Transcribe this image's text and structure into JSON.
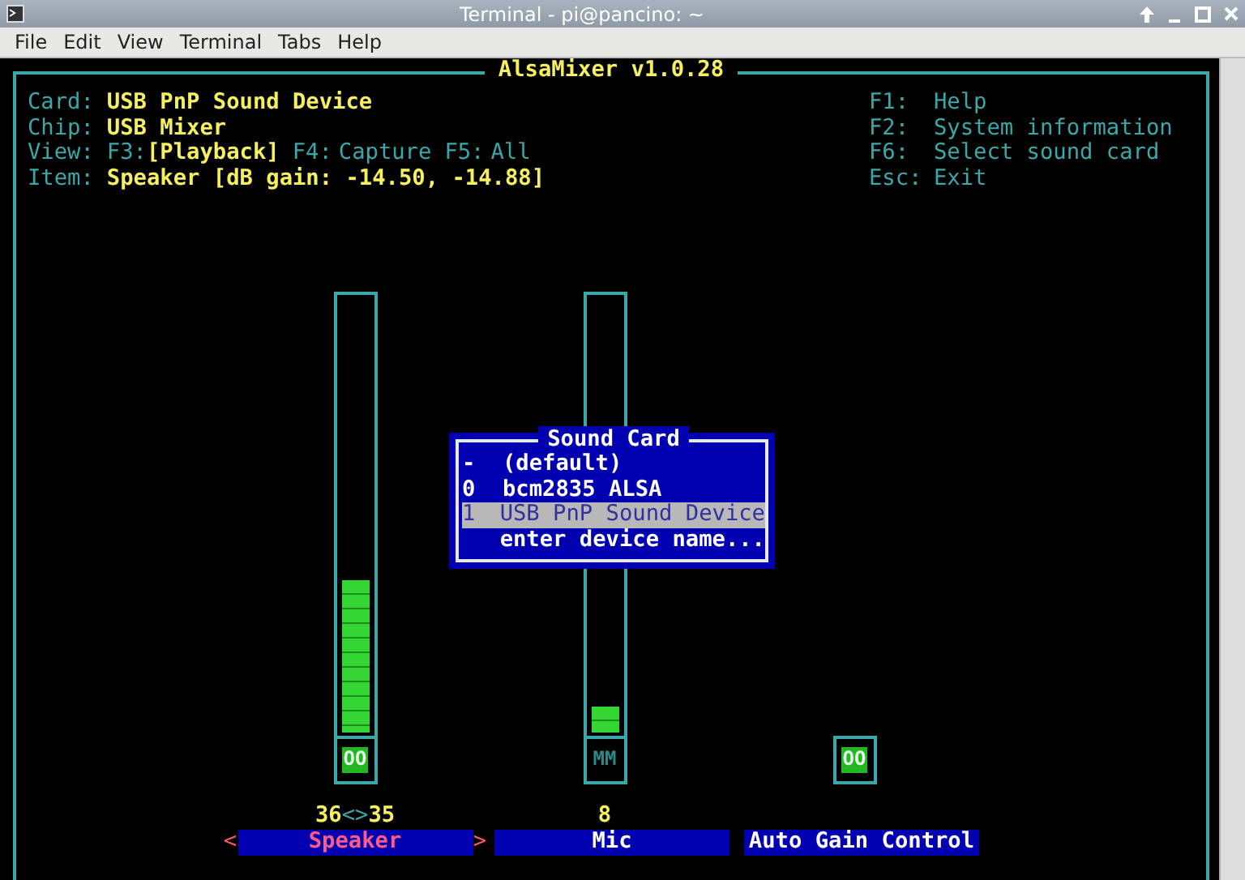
{
  "window": {
    "title": "Terminal - pi@pancino: ~"
  },
  "menu": [
    "File",
    "Edit",
    "View",
    "Terminal",
    "Tabs",
    "Help"
  ],
  "mixer": {
    "title": "AlsaMixer v1.0.28",
    "info": [
      {
        "label": "Card:",
        "value": "USB PnP Sound Device"
      },
      {
        "label": "Chip:",
        "value": "USB Mixer"
      }
    ],
    "views_label": "View:",
    "views": [
      {
        "key": "F3:",
        "label": "[Playback]",
        "selected": true
      },
      {
        "key": "F4:",
        "label": "Capture",
        "selected": false
      },
      {
        "key": "F5:",
        "label": "All",
        "selected": false
      }
    ],
    "item": {
      "label": "Item:",
      "value": "Speaker [dB gain: -14.50, -14.88]"
    },
    "help": [
      {
        "key": "F1:",
        "text": "Help"
      },
      {
        "key": "F2:",
        "text": "System information"
      },
      {
        "key": "F6:",
        "text": "Select sound card"
      },
      {
        "key": "Esc:",
        "text": "Exit"
      }
    ],
    "channels": [
      {
        "kind": "slider",
        "name": "Speaker",
        "selected": true,
        "level": 0.35,
        "muted": false,
        "switch_text": "OO",
        "values": [
          "36",
          "<>",
          "35"
        ],
        "left_marker": "<",
        "right_marker": ">"
      },
      {
        "kind": "slider",
        "name": "Mic",
        "selected": false,
        "level": 0.06,
        "muted": true,
        "switch_text": "MM",
        "values": [
          "8"
        ]
      },
      {
        "kind": "switch",
        "name": "Auto Gain Control",
        "selected": false,
        "muted": false,
        "switch_text": "OO"
      }
    ]
  },
  "dialog": {
    "title": "Sound Card",
    "items": [
      {
        "index": "-",
        "name": "(default)",
        "selected": false
      },
      {
        "index": "0",
        "name": "bcm2835 ALSA",
        "selected": false
      },
      {
        "index": "1",
        "name": "USB PnP Sound Device",
        "selected": true
      },
      {
        "name": "enter device name...",
        "selected": false
      }
    ]
  }
}
